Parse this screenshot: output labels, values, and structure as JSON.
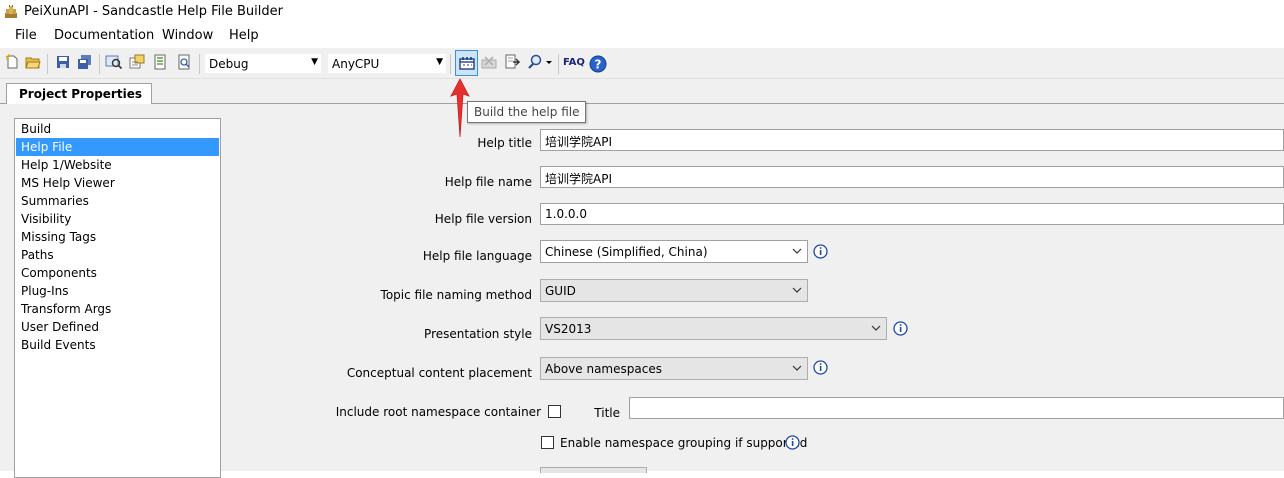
{
  "window": {
    "title": "PeiXunAPI - Sandcastle Help File Builder"
  },
  "menu": [
    {
      "label": "File",
      "access": "F"
    },
    {
      "label": "Documentation",
      "access": "D"
    },
    {
      "label": "Window",
      "access": "W"
    },
    {
      "label": "Help",
      "access": "H"
    }
  ],
  "toolbar": {
    "configuration": "Debug",
    "platform": "AnyCPU",
    "faq_label": "FAQ",
    "build_tooltip": "Build the help file"
  },
  "tabs": [
    {
      "label": "Project Properties"
    }
  ],
  "nav": {
    "items": [
      "Build",
      "Help File",
      "Help 1/Website",
      "MS Help Viewer",
      "Summaries",
      "Visibility",
      "Missing Tags",
      "Paths",
      "Components",
      "Plug-Ins",
      "Transform Args",
      "User Defined",
      "Build Events"
    ],
    "selected_index": 1
  },
  "form": {
    "help_title": {
      "label": "Help title",
      "value": "培训学院API"
    },
    "help_file_name": {
      "label": "Help file name",
      "value": "培训学院API"
    },
    "help_file_version": {
      "label": "Help file version",
      "value": "1.0.0.0"
    },
    "help_file_language": {
      "label": "Help file language",
      "value": "Chinese (Simplified, China)"
    },
    "topic_naming": {
      "label": "Topic file naming method",
      "value": "GUID"
    },
    "presentation_style": {
      "label": "Presentation style",
      "value": "VS2013"
    },
    "conceptual_placement": {
      "label": "Conceptual content placement",
      "value": "Above namespaces"
    },
    "root_namespace": {
      "label": "Include root namespace container",
      "checked": false
    },
    "root_title": {
      "label": "Title",
      "value": ""
    },
    "namespace_grouping": {
      "label": "Enable namespace grouping if supported",
      "checked": false
    }
  },
  "colors": {
    "selection": "#3399ff",
    "accent_red": "#e5302f",
    "highlight_border": "#3c8fd9"
  }
}
